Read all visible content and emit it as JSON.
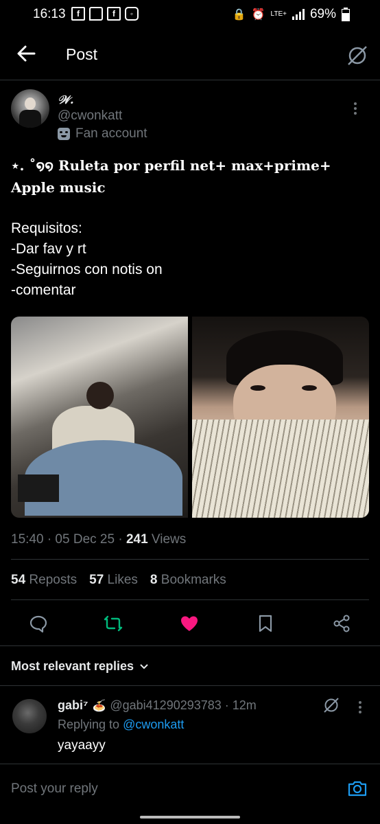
{
  "status_bar": {
    "time": "16:13",
    "signal_label": "LTE+",
    "battery": "69%"
  },
  "header": {
    "title": "Post"
  },
  "tweet": {
    "display_name": "𝒲.",
    "handle": "@cwonkatt",
    "label": "Fan account",
    "line1": "⋆. ˚໑໑ Ruleta por perfil net+ max+prime+ Apple music",
    "body_lines": [
      "Requisitos:",
      "-Dar fav y rt",
      "-Seguirnos con notis on",
      "-comentar"
    ],
    "timestamp": "15:40 · 05 Dec 25 · ",
    "views_count": "241",
    "views_label": " Views",
    "reposts_count": "54",
    "reposts_label": "Reposts",
    "likes_count": "57",
    "likes_label": "Likes",
    "bookmarks_count": "8",
    "bookmarks_label": "Bookmarks"
  },
  "replies_header": "Most relevant replies",
  "reply": {
    "name": "gabi⁷",
    "emoji": "🍝",
    "handle_time": "@gabi41290293783 · 12m",
    "replying_to_label": "Replying to ",
    "replying_to_handle": "@cwonkatt",
    "text": "yayaayy"
  },
  "reply_input": {
    "placeholder": "Post your reply"
  },
  "colors": {
    "accent": "#1d9bf0",
    "like": "#f91880",
    "repost": "#00ba7c",
    "muted": "#71767b"
  },
  "icons": [
    "back-arrow-icon",
    "grok-icon",
    "more-icon",
    "reply-icon",
    "repost-icon",
    "like-icon",
    "bookmark-icon",
    "share-icon",
    "chevron-down-icon",
    "camera-icon"
  ]
}
